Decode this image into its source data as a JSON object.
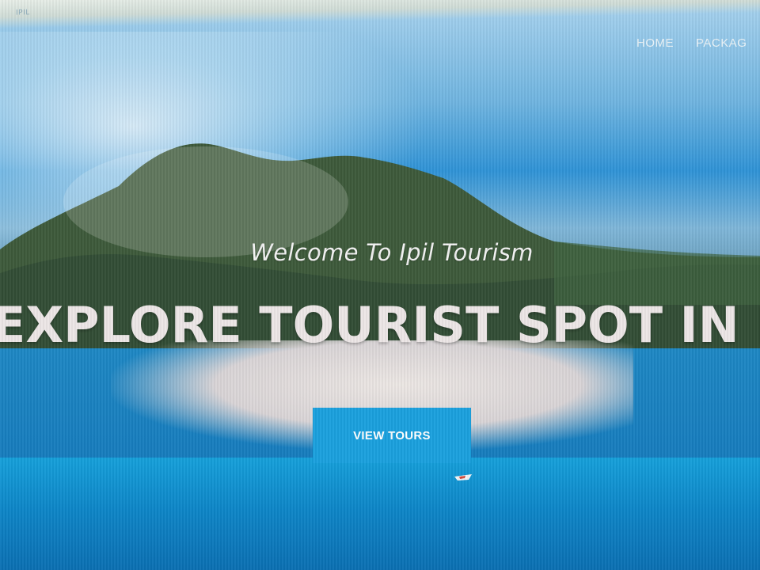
{
  "site": {
    "brand_small": "IPIL"
  },
  "nav": {
    "items": [
      {
        "label": "HOME"
      },
      {
        "label": "PACKAG"
      }
    ]
  },
  "hero": {
    "welcome": "Welcome To Ipil Tourism",
    "headline": "EXPLORE TOURIST SPOT IN I",
    "cta_label": "VIEW TOURS"
  },
  "colors": {
    "accent": "#1aa0de",
    "text_light": "#ece6e6"
  }
}
